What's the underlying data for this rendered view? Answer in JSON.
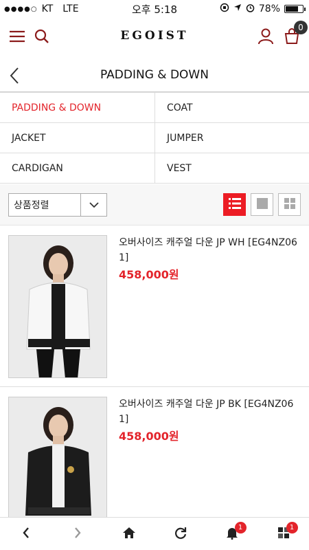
{
  "status_bar": {
    "signal": "●●●●○",
    "carrier": "KT",
    "network": "LTE",
    "time": "오후 5:18",
    "battery_text": "78%",
    "battery_level": 0.78
  },
  "header": {
    "logo": "EGOIST",
    "cart_count": "0",
    "icons": [
      "menu-icon",
      "search-icon",
      "user-icon",
      "cart-icon"
    ]
  },
  "title_bar": {
    "title": "PADDING & DOWN"
  },
  "categories": [
    {
      "label": "PADDING & DOWN",
      "active": true
    },
    {
      "label": "COAT",
      "active": false
    },
    {
      "label": "JACKET",
      "active": false
    },
    {
      "label": "JUMPER",
      "active": false
    },
    {
      "label": "CARDIGAN",
      "active": false
    },
    {
      "label": "VEST",
      "active": false
    }
  ],
  "sort": {
    "selected": "상품정렬"
  },
  "view_modes": [
    "list",
    "single",
    "grid"
  ],
  "view_selected": "list",
  "products": [
    {
      "name": "오버사이즈 캐주얼 다운 JP WH [EG4NZ061]",
      "price": "458,000원",
      "jacket_color": "white"
    },
    {
      "name": "오버사이즈 캐주얼 다운 JP BK [EG4NZ061]",
      "price": "458,000원",
      "jacket_color": "black"
    }
  ],
  "bottom_nav": {
    "items": [
      "back-arrow-icon",
      "forward-arrow-icon",
      "home-icon",
      "refresh-icon",
      "bell-icon",
      "apps-icon"
    ],
    "bell_badge": "1",
    "apps_badge": "1"
  },
  "colors": {
    "accent": "#e3242b",
    "header_icon": "#8b1a1a"
  }
}
